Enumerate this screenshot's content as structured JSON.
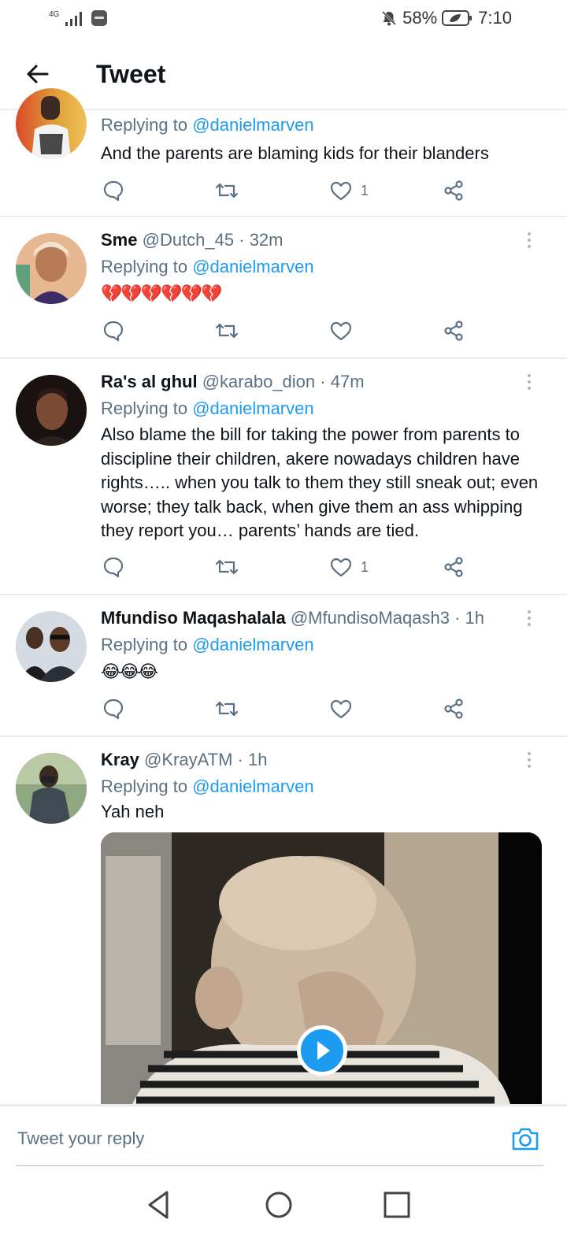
{
  "status_bar": {
    "network": "4G",
    "battery_percent": "58%",
    "time": "7:10"
  },
  "header": {
    "title": "Tweet"
  },
  "tweets": [
    {
      "name": "",
      "handle": "",
      "time": "",
      "replying_prefix": "Replying to ",
      "replying_to": "@danielmarven",
      "text": "And the parents are blaming kids for their blanders",
      "likes": "1"
    },
    {
      "name": "Sme",
      "handle": "@Dutch_45",
      "time": "· 32m",
      "replying_prefix": "Replying to ",
      "replying_to": "@danielmarven",
      "text": "💔💔💔💔💔💔",
      "likes": ""
    },
    {
      "name": "Ra's al ghul",
      "handle": "@karabo_dion",
      "time": "· 47m",
      "replying_prefix": "Replying to ",
      "replying_to": "@danielmarven",
      "text": "Also blame the bill for taking the power from parents to discipline their children, akere nowadays children have rights….. when you talk to them they still sneak out; even worse; they talk back, when give them an ass whipping they report you… parents’ hands are tied.",
      "likes": "1"
    },
    {
      "name": "Mfundiso Maqashalala",
      "handle": "@MfundisoMaqash3",
      "time": "· 1h",
      "replying_prefix": "Replying to ",
      "replying_to": "@danielmarven",
      "text": "😂😂😂",
      "likes": ""
    },
    {
      "name": "Kray",
      "handle": "@KrayATM",
      "time": "· 1h",
      "replying_prefix": "Replying to ",
      "replying_to": "@danielmarven",
      "text": "Yah neh",
      "likes": ""
    }
  ],
  "reply_box": {
    "placeholder": "Tweet your reply"
  },
  "icons": {
    "reply": "comment-icon",
    "retweet": "retweet-icon",
    "like": "heart-icon",
    "share": "share-icon"
  },
  "colors": {
    "accent": "#1d9bf0",
    "secondary_text": "#5b7083",
    "divider": "#e6ecf0"
  }
}
